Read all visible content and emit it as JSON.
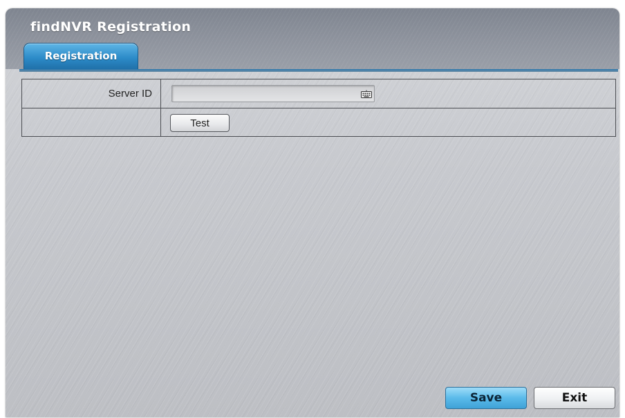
{
  "window": {
    "title": "findNVR Registration"
  },
  "tabs": [
    {
      "label": "Registration",
      "active": true
    }
  ],
  "form": {
    "server_id": {
      "label": "Server ID",
      "value": "",
      "icon": "keyboard-icon"
    },
    "test_button": "Test"
  },
  "footer": {
    "save_label": "Save",
    "exit_label": "Exit"
  },
  "colors": {
    "accent_tab": "#2c8bc8",
    "save_button": "#5bbbea",
    "titlebar": "#8f949e",
    "panel_background": "#c7c9ce"
  }
}
